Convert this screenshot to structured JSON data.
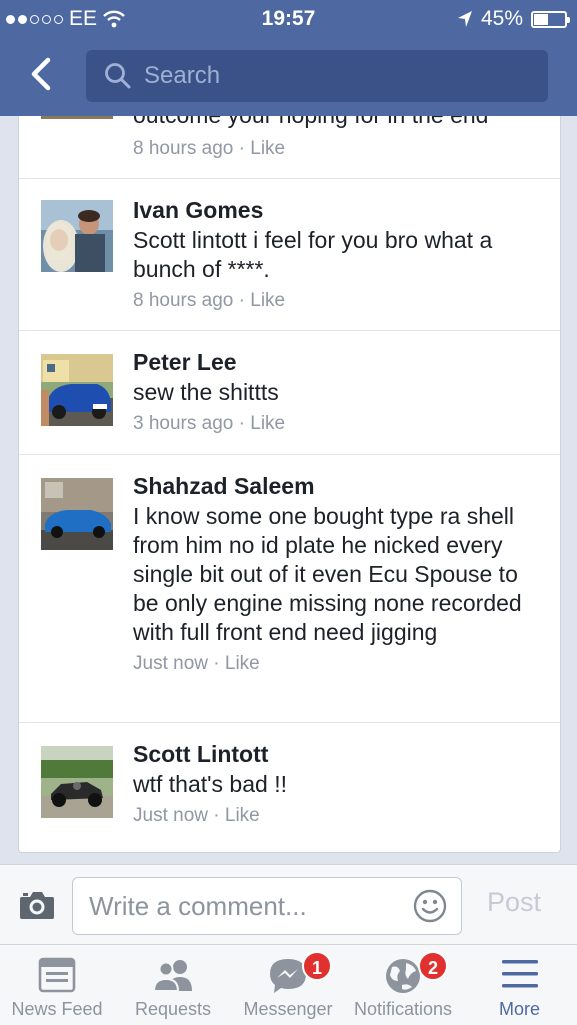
{
  "status": {
    "carrier": "EE",
    "time": "19:57",
    "battery": "45%",
    "battery_level": 0.45
  },
  "nav": {
    "search_placeholder": "Search"
  },
  "partial_comment": {
    "text": "outcome your hoping for in the end",
    "time": "8 hours ago",
    "like": "Like"
  },
  "comments": [
    {
      "author": "Ivan Gomes",
      "text": "Scott lintott i feel for you bro what a bunch of ****.",
      "time": "8 hours ago",
      "like": "Like"
    },
    {
      "author": "Peter Lee",
      "text": "sew the shittts",
      "time": "3 hours ago",
      "like": "Like"
    },
    {
      "author": "Shahzad Saleem",
      "text": "I know some one bought type ra shell from him no id plate he nicked every single bit out of it even Ecu Spouse to be only engine missing none recorded with full front end need jigging",
      "time": "Just now",
      "like": "Like"
    },
    {
      "author": "Scott Lintott",
      "text": "wtf that's bad !!",
      "time": "Just now",
      "like": "Like"
    }
  ],
  "composer": {
    "placeholder": "Write a comment...",
    "post_label": "Post"
  },
  "tabs": [
    {
      "label": "News Feed",
      "icon": "news-feed-icon"
    },
    {
      "label": "Requests",
      "icon": "requests-icon"
    },
    {
      "label": "Messenger",
      "icon": "messenger-icon",
      "badge": "1"
    },
    {
      "label": "Notifications",
      "icon": "notifications-icon",
      "badge": "2"
    },
    {
      "label": "More",
      "icon": "more-icon"
    }
  ],
  "colors": {
    "brand": "#4e69a2",
    "active_tab": "#4e69a2",
    "badge": "#e0312e"
  }
}
